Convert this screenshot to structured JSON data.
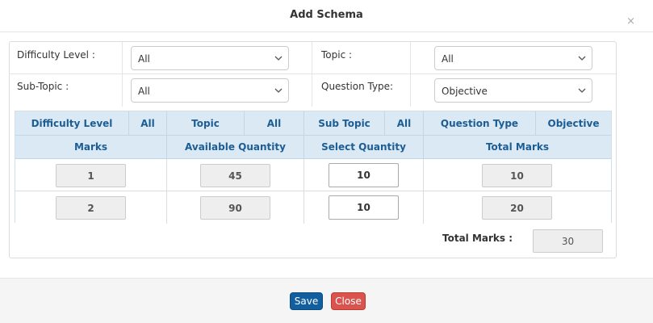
{
  "dialog": {
    "title": "Add Schema",
    "close_glyph": "×"
  },
  "filters": {
    "difficulty_label": "Difficulty Level :",
    "difficulty_value": "All",
    "topic_label": "Topic :",
    "topic_value": "All",
    "subtopic_label": "Sub-Topic :",
    "subtopic_value": "All",
    "question_type_label": "Question Type:",
    "question_type_value": "Objective"
  },
  "table": {
    "summary_row": {
      "difficulty_label": "Difficulty Level",
      "difficulty_value": "All",
      "topic_label": "Topic",
      "topic_value": "All",
      "subtopic_label": "Sub Topic",
      "subtopic_value": "All",
      "question_type_label": "Question Type",
      "question_type_value": "Objective"
    },
    "columns": [
      "Marks",
      "Available Quantity",
      "Select Quantity",
      "Total Marks"
    ],
    "rows": [
      {
        "marks": "1",
        "available": "45",
        "select": "10",
        "total": "10"
      },
      {
        "marks": "2",
        "available": "90",
        "select": "10",
        "total": "20"
      }
    ]
  },
  "totals": {
    "label": "Total Marks :",
    "value": "30"
  },
  "footer": {
    "save_label": "Save",
    "close_label": "Close"
  },
  "colors": {
    "header_bg": "#dbe9f5",
    "header_text": "#1c5d94",
    "save_button": "#125f9f",
    "close_button": "#d9534f"
  }
}
